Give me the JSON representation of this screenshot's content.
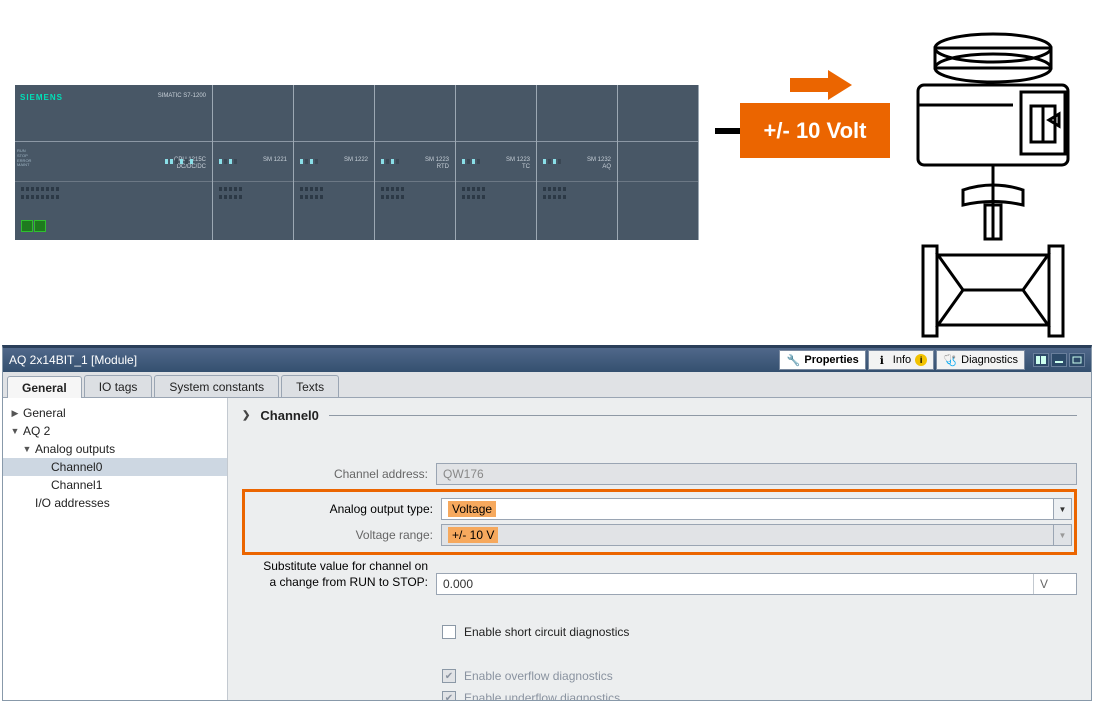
{
  "hardware": {
    "brand": "SIEMENS",
    "family": "SIMATIC S7-1200",
    "cpu_label": "CPU 1215C\nDC/DC/DC",
    "sm_labels": [
      "SM 1221",
      "SM 1222",
      "SM 1223\nRTD",
      "SM 1223\nTC",
      "SM 1232\nAQ"
    ],
    "signal_label": "+/- 10 Volt"
  },
  "panel": {
    "title": "AQ 2x14BIT_1 [Module]",
    "titletabs": {
      "properties": "Properties",
      "info": "Info",
      "diagnostics": "Diagnostics"
    },
    "tabs": [
      "General",
      "IO tags",
      "System constants",
      "Texts"
    ],
    "active_tab": 0
  },
  "nav": [
    {
      "level": 0,
      "expand": "▶",
      "label": "General",
      "sel": false
    },
    {
      "level": 0,
      "expand": "▼",
      "label": "AQ 2",
      "sel": false
    },
    {
      "level": 1,
      "expand": "▼",
      "label": "Analog outputs",
      "sel": false
    },
    {
      "level": 2,
      "expand": "",
      "label": "Channel0",
      "sel": true
    },
    {
      "level": 2,
      "expand": "",
      "label": "Channel1",
      "sel": false
    },
    {
      "level": 1,
      "expand": "",
      "label": "I/O addresses",
      "sel": false
    }
  ],
  "form": {
    "section": "Channel0",
    "channel_addr_label": "Channel address:",
    "channel_addr_value": "QW176",
    "output_type_label": "Analog output type:",
    "output_type_value": "Voltage",
    "range_label": "Voltage range:",
    "range_value": "+/- 10 V",
    "sub_label_1": "Substitute value for channel on",
    "sub_label_2": "a change from RUN to STOP:",
    "sub_value": "0.000",
    "sub_unit": "V",
    "chk1": "Enable short circuit diagnostics",
    "chk2": "Enable overflow diagnostics",
    "chk3": "Enable underflow diagnostics"
  }
}
